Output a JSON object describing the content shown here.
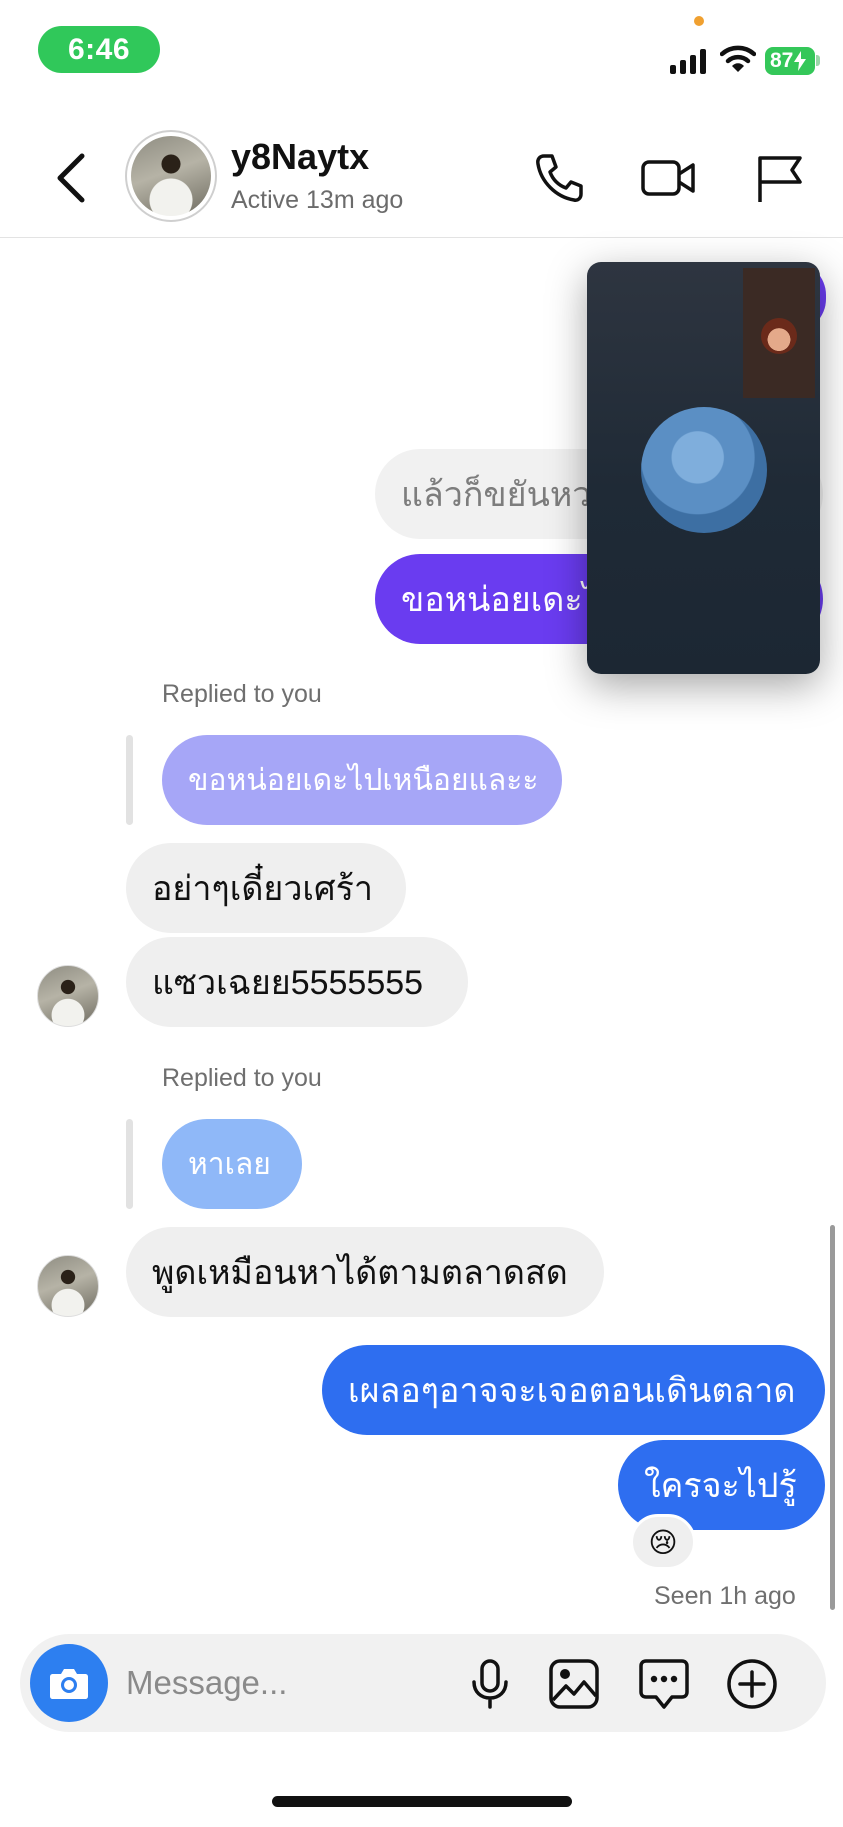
{
  "status_bar": {
    "time": "6:46",
    "battery": "87"
  },
  "header": {
    "contact_name": "y8Naytx",
    "contact_status": "Active 13m ago",
    "icons": [
      "back-chevron-icon",
      "phone-icon",
      "video-camera-icon",
      "flag-icon"
    ]
  },
  "messages": [
    {
      "side": "sent",
      "style": "faded",
      "text": "แล้วก็ขยันหวาน",
      "note": "partially covered by video"
    },
    {
      "side": "sent",
      "style": "purple",
      "text": "ขอหน่อยเดะไ"
    },
    {
      "side": "received",
      "reply_label": "Replied to you",
      "quoted": "ขอหน่อยเดะไปเหนือยและะ",
      "text": "อย่าๆเดี๋ยวเศร้า"
    },
    {
      "side": "received",
      "text": "แซวเฉยย5555555"
    },
    {
      "side": "received",
      "reply_label": "Replied to you",
      "quoted": "หาเลย",
      "text": "พูดเหมือนหาได้ตามตลาดสด"
    },
    {
      "side": "sent",
      "style": "blue",
      "text": "เผลอๆอาจจะเจอตอนเดินตลาด"
    },
    {
      "side": "sent",
      "style": "blue",
      "text": "ใครจะไปรู้"
    }
  ],
  "reaction": "😢",
  "seen": "Seen 1h ago",
  "composer": {
    "placeholder": "Message...",
    "icons": [
      "camera-icon",
      "microphone-icon",
      "image-gallery-icon",
      "sticker-chat-icon",
      "plus-circle-icon"
    ]
  },
  "colors": {
    "sent_purple": "#6a3cf0",
    "sent_blue": "#2e6ef0",
    "received_grey": "#efefef",
    "status_green": "#30c85a",
    "camera_blue": "#2d7ff0"
  }
}
